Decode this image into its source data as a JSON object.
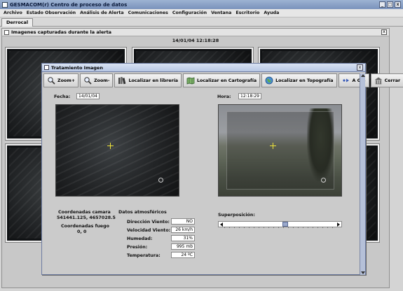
{
  "window": {
    "title": "GESMACOM(r) Centro de proceso de datos",
    "minimize": "_",
    "maximize": "□",
    "close": "x"
  },
  "menu": [
    "Archivo",
    "Estado Observación",
    "Análisis de Alerta",
    "Comunicaciones",
    "Configuración",
    "Ventana",
    "Escritorio",
    "Ayuda"
  ],
  "tab": {
    "label": "Derrocal"
  },
  "capture_frame": {
    "title": "Imagenes capturadas durante la alerta",
    "timestamp": "14/01/04 12:18:28",
    "close": "x"
  },
  "dialog": {
    "title": "Tratamiento Imagen",
    "close": "x",
    "toolbar": {
      "zoom_in": "Zoom+",
      "zoom_out": "Zoom-",
      "locate_library": "Localizar en librería",
      "locate_cartography": "Localizar en Cartografía",
      "locate_topography": "Localizar en Topografía",
      "gis": "A GIS",
      "close": "Cerrar"
    },
    "date_label": "Fecha:",
    "date_value": "14/01/04",
    "time_label": "Hora:",
    "time_value": "12:18:29",
    "coords": {
      "camera_label": "Coordenadas camara",
      "camera_value": "541441.125, 4657028.5",
      "fire_label": "Coordenadas fuego",
      "fire_value": "0, 0"
    },
    "atmos": {
      "heading": "Datos atmosféricos",
      "wind_dir_label": "Dirección Viento:",
      "wind_dir_value": "NO",
      "wind_speed_label": "Velocidad Viento:",
      "wind_speed_value": "26 km/h",
      "humidity_label": "Humedad:",
      "humidity_value": "31%",
      "pressure_label": "Presión:",
      "pressure_value": "995 mb",
      "temperature_label": "Temperatura:",
      "temperature_value": "24 ºC"
    },
    "overlay": {
      "label": "Superposición:",
      "value": 0.55
    }
  }
}
